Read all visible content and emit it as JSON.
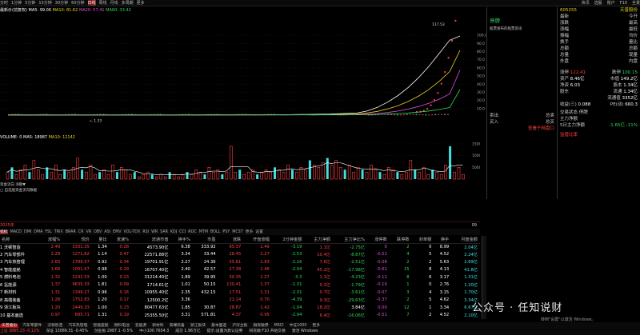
{
  "topbar": {
    "tabs": [
      "分时",
      "1分钟",
      "5分钟",
      "15分钟",
      "30分钟",
      "60分钟",
      "日线",
      "周线",
      "月线",
      "多周期",
      "更多"
    ],
    "active_tab": "日线",
    "right_items": [
      "资讯",
      "选股",
      "账户",
      "F10",
      "全景"
    ]
  },
  "info": {
    "title": "最新价(前复权)",
    "ma5": "MA5: 99.06",
    "ma10": "MA10: 81.62",
    "ma20": "MA20: 57.41",
    "ma60": "MA60: 33.42"
  },
  "chart_data": {
    "type": "line",
    "title": "",
    "xlabel": "",
    "ylabel": "",
    "price_ylim": [
      0,
      110
    ],
    "price_ticks": [
      "100.0",
      "90.0",
      "80.0",
      "70.0",
      "60.0",
      "50.0",
      "40.0",
      "30.0",
      "20.0",
      "10.0"
    ],
    "close_last": 122.41,
    "low_marker": "1.33",
    "high_marker": "117.53",
    "series": [
      {
        "name": "MA5",
        "values": [
          2.1,
          2.0,
          2.1,
          2.2,
          2.1,
          2.3,
          2.4,
          2.6,
          3.2,
          4.5,
          7.0,
          11.5,
          18.0,
          26.0,
          36.0,
          48.0,
          62.0,
          78.0,
          94.0,
          99.06
        ]
      },
      {
        "name": "MA10",
        "values": [
          2.2,
          2.1,
          2.1,
          2.1,
          2.1,
          2.2,
          2.3,
          2.4,
          2.7,
          3.3,
          4.6,
          6.6,
          9.6,
          13.6,
          18.8,
          25.4,
          33.6,
          43.6,
          55.5,
          81.62
        ]
      },
      {
        "name": "MA20",
        "values": [
          2.3,
          2.2,
          2.2,
          2.2,
          2.2,
          2.2,
          2.2,
          2.3,
          2.4,
          2.6,
          3.1,
          3.9,
          5.2,
          7.0,
          9.4,
          12.6,
          16.6,
          21.6,
          28.0,
          57.41
        ]
      },
      {
        "name": "MA60",
        "values": [
          2.5,
          2.4,
          2.4,
          2.3,
          2.3,
          2.3,
          2.3,
          2.3,
          2.3,
          2.4,
          2.5,
          2.8,
          3.2,
          3.8,
          4.6,
          5.7,
          7.1,
          8.9,
          11.3,
          33.42
        ]
      }
    ],
    "volume": {
      "label_vol": "VOLUME: 0",
      "label_ma5": "MA5: 18987",
      "label_ma10": "MA10: 12142",
      "ticks": [
        "15000",
        "10000",
        "5000"
      ],
      "values": [
        3,
        5,
        2,
        4,
        6,
        3,
        8,
        4,
        2,
        5,
        3,
        6,
        2,
        4,
        3,
        5,
        9,
        4,
        3,
        6,
        2,
        3,
        4,
        2,
        6,
        3,
        5,
        4,
        2,
        3,
        1,
        2,
        3,
        2,
        1,
        2,
        1,
        3,
        2,
        1,
        2,
        3,
        2,
        4,
        3,
        2,
        5,
        3,
        4,
        2,
        3,
        14,
        3,
        4,
        2,
        3,
        4,
        2,
        3,
        4,
        3,
        5,
        4,
        3,
        6,
        4,
        3,
        5,
        4,
        8,
        6,
        5,
        7,
        9,
        6,
        8,
        5,
        4,
        6,
        3,
        5,
        4,
        3,
        6,
        4,
        3,
        2,
        5,
        4,
        3,
        2,
        3,
        8,
        4,
        3,
        5,
        2,
        4,
        3,
        2,
        6,
        14,
        3,
        5,
        2
      ]
    }
  },
  "flow": {
    "line1": "资金流向  净额▼",
    "line2": "□ 自选股资金流向数据"
  },
  "axis": {
    "left": "2025年",
    "right": "09"
  },
  "ind_tabs": [
    "指标",
    "MACD",
    "DMI",
    "DMA",
    "FSL",
    "TRIX",
    "BRAR",
    "CR",
    "VR",
    "OBV",
    "ASI",
    "EMV",
    "VOL-TDX",
    "RSI",
    "WR",
    "SAR",
    "KDJ",
    "CCI",
    "ROC",
    "MTM",
    "BOLL",
    "PSY",
    "MCST",
    "更多",
    "设置"
  ],
  "ind_active": "指标",
  "mid": {
    "head": "停牌",
    "note": "股票发布的股票资讯",
    "r1": [
      "卖出",
      "总卖"
    ],
    "r2": [
      "买入",
      "总买"
    ],
    "link": "查看千档盘口"
  },
  "right": {
    "code": "605255",
    "name": "天普股份",
    "rows": [
      [
        "最新",
        "今开"
      ],
      [
        "涨跌",
        "最高"
      ],
      [
        "涨幅",
        "最低"
      ],
      [
        "振幅",
        "均价"
      ],
      [
        "换手",
        "量比"
      ],
      [
        "总额",
        "总额"
      ],
      [
        "总量",
        "现量"
      ],
      [
        "外盘",
        "内盘"
      ]
    ],
    "stats": [
      {
        "k": "涨停",
        "v": "122.41",
        "k2": "跌停",
        "v2": "100.15"
      },
      {
        "k": "资产",
        "v": "8.46亿",
        "k2": "市值",
        "v2": "149.2亿"
      },
      {
        "k": "净资",
        "v": "6.03",
        "k2": "股本",
        "v2": "1.34亿"
      },
      {
        "k": "股东",
        "v": "",
        "k2": "流通",
        "v2": "1.34亿"
      },
      {
        "k": "",
        "v": "",
        "k2": "流通值",
        "v2": "3352亿"
      },
      {
        "k": "收益(三)",
        "v": "0.088",
        "k2": "PE(动)",
        "v2": "660.3"
      }
    ],
    "trade_status": "交易状态  停牌",
    "main_net": "主力净额",
    "net_label": "5日主力净额",
    "net_val": "-1.65亿",
    "net_pct": "-11%",
    "link": "监管比率"
  },
  "table": {
    "headers": [
      "名称",
      "涨幅%",
      "现价",
      "量比",
      "涨速%",
      "流通市值",
      "换手%",
      "市盈",
      "涨跌",
      "开盘涨幅",
      "2分钟金额",
      "主力净额",
      "主力净比%",
      "涨停数",
      "跌停数",
      "封单额",
      "换手",
      "月盘金额"
    ],
    "rows": [
      [
        "沃顿智造",
        "2.49",
        "3331.35",
        "1.34",
        "0.28",
        "4573.90亿",
        "6.38",
        "333.92",
        "95.37",
        "2.49",
        "-3.19",
        "1.1亿",
        "-2.75亿",
        "0",
        "2",
        "0",
        "8.99",
        "2.04亿"
      ],
      [
        "汽车零部件",
        "2.29",
        "1271.62",
        "1.14",
        "0.47",
        "22571.88亿",
        "3.34",
        "33.44",
        "28.45",
        "2.27",
        "-2.53",
        "10.4亿",
        "-8.87亿",
        "-0.51",
        "4",
        "5",
        "4.52",
        "2.24亿"
      ],
      [
        "汽车热管理",
        "2.83",
        "1789.57",
        "0.92",
        "0.34",
        "19701.91亿",
        "2.27",
        "24.36",
        "35.61",
        "2.83",
        "-2.16",
        "7.6亿",
        "-2.51亿",
        "-0.08",
        "2",
        "2",
        "5.63",
        "2.69亿"
      ],
      [
        "智能座舱",
        "1.68",
        "1001.67",
        "0.98",
        "0.29",
        "16707.40亿",
        "2.40",
        "42.57",
        "27.38",
        "1.46",
        "-2.04",
        "45.2亿",
        "-17.98亿",
        "-0.61",
        "15",
        "8",
        "4.13",
        "41.8亿"
      ],
      [
        "燃料电池",
        "1.32",
        "2242.53",
        "1.00",
        "0.23",
        "31214.40亿",
        "1.89",
        "39.95",
        "30.35",
        "1.27",
        "-3.3",
        "1.1亿",
        "-4.23亿",
        "-0.11",
        "8",
        "6",
        "3.17",
        "1.31亿"
      ],
      [
        "氢能源",
        "1.37",
        "9635.33",
        "1.81",
        "0.09",
        "1714.61亿",
        "1.01",
        "50.15",
        "130.41",
        "1.37",
        "-1.31",
        "0.2亿",
        "-1.79亿",
        "-0.10",
        "1",
        "0",
        "2.76",
        "1.20亿"
      ],
      [
        "新材料",
        "1.31",
        "1349.27",
        "0.96",
        "0.16",
        "10955.40亿",
        "2.35",
        "432.15",
        "17.51",
        "1.31",
        "-2.31",
        "0.7亿",
        "-3.61亿",
        "-0.07",
        "3",
        "4",
        "3.15",
        "1.70亿"
      ],
      [
        "高端装备",
        "1.28",
        "1752.83",
        "1.20",
        "0.17",
        "12500.2亿",
        "3.36",
        "",
        "22.14",
        "0.70",
        "-4.39",
        "9.3亿",
        "-29.63亿",
        "-0.37",
        "2",
        "5",
        "4.62",
        "3.34亿"
      ],
      [
        "浙江板块",
        "1.20",
        "2449.33",
        "1.00",
        "0.23",
        "80477.63亿",
        "1.85",
        "30.87",
        "28.87",
        "1.42",
        "-1.04",
        "18.2亿",
        "3.84亿",
        "0.00",
        "12",
        "1",
        "3.34",
        "6.67亿"
      ],
      [
        "基本面选",
        "0.97",
        "685.71",
        "1.31",
        "0.19",
        "25355.50亿",
        "3.31",
        "571.81",
        "4.37",
        "0.95",
        "-2.94",
        "6.4亿",
        "-16.06亿",
        "-0.51",
        "7",
        "2",
        "4.52",
        "2.10亿"
      ]
    ]
  },
  "bottom_tabs": [
    "天普股份",
    "汽车零部件",
    "沃顿智造",
    "汽车热管理",
    "智能座舱",
    "燃料电池",
    "氢能源",
    "新材料",
    "高端装备",
    "浙江板块",
    "基本面选",
    "沪深主板",
    "融资融券",
    "MSCI",
    "中证1000",
    "更多"
  ],
  "bottom_active": "天普股份",
  "status": [
    "上证 3865.23 -0.12%",
    "深证 13089.31 -0.45%",
    "创业板 2987.1 -0.5%",
    "中小100 7654.3",
    "成交 1.96万亿",
    "提示:设置为默认证券",
    "同花顺 F10 开始交易",
    "激活 Windows"
  ],
  "watermark": "公众号 · 任知说财",
  "watermark2": "转到\"设置\"以激活 Windows。",
  "colors": {
    "up": "#ff4040",
    "down": "#2fd85a",
    "ma5": "#ffffff",
    "ma10": "#e6d21e",
    "ma20": "#e050e0",
    "ma60": "#2fd85a",
    "vol_up": "#ff4040",
    "vol_down": "#3fe0e0"
  }
}
